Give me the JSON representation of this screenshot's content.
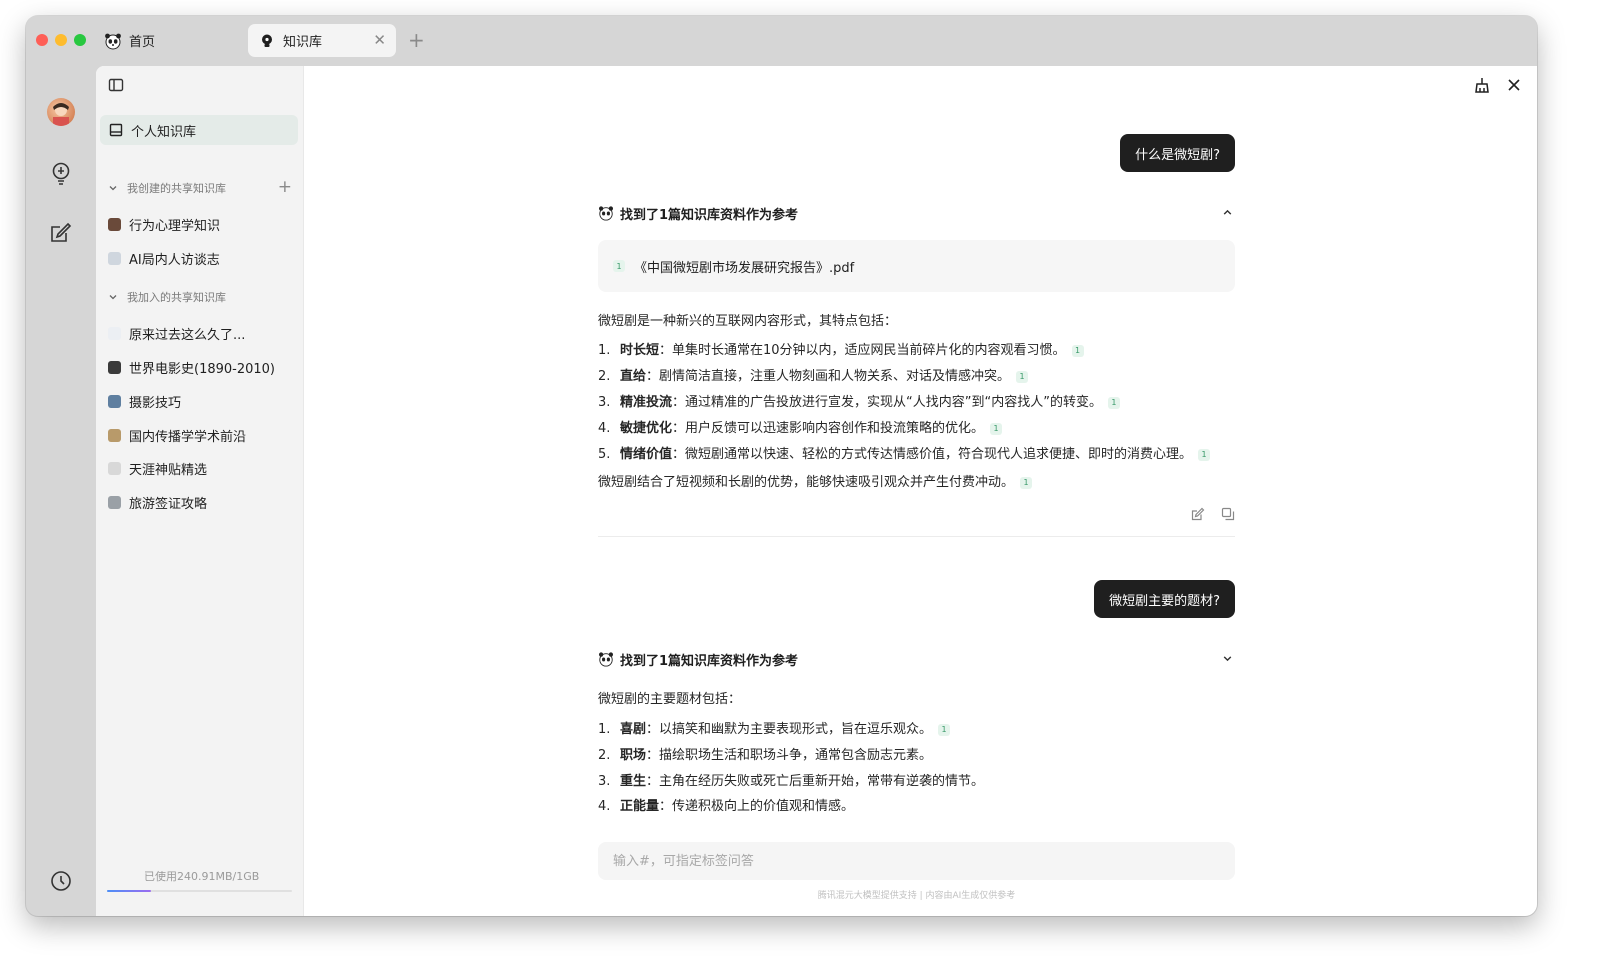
{
  "tabs": [
    {
      "label": "首页"
    },
    {
      "label": "知识库"
    }
  ],
  "sidebar": {
    "personal_label": "个人知识库",
    "created_section": "我创建的共享知识库",
    "created_items": [
      {
        "label": "行为心理学知识",
        "color": "#6a4a3a"
      },
      {
        "label": "AI局内人访谈志",
        "color": "#cfd6de"
      }
    ],
    "joined_section": "我加入的共享知识库",
    "joined_items": [
      {
        "label": "原来过去这么久了...",
        "color": "#eceff3"
      },
      {
        "label": "世界电影史(1890-2010)",
        "color": "#3a3a3a"
      },
      {
        "label": "摄影技巧",
        "color": "#5f7fa0"
      },
      {
        "label": "国内传播学学术前沿",
        "color": "#b89a6a"
      },
      {
        "label": "天涯神贴精选",
        "color": "#d8d8d8"
      },
      {
        "label": "旅游签证攻略",
        "color": "#9aa0a6"
      }
    ],
    "usage": "已使用240.91MB/1GB",
    "usage_fraction": 0.24
  },
  "chat": {
    "q1": "什么是微短剧?",
    "ref1_title": "找到了1篇知识库资料作为参考",
    "ref1_doc": "《中国微短剧市场发展研究报告》.pdf",
    "cite": "1",
    "a1_intro": "微短剧是一种新兴的互联网内容形式，其特点包括：",
    "a1_items": [
      {
        "num": "1.",
        "term": "时长短",
        "text": "：单集时长通常在10分钟以内，适应网民当前碎片化的内容观看习惯。"
      },
      {
        "num": "2.",
        "term": "直给",
        "text": "：剧情简洁直接，注重人物刻画和人物关系、对话及情感冲突。"
      },
      {
        "num": "3.",
        "term": "精准投流",
        "text": "：通过精准的广告投放进行宣发，实现从“人找内容”到“内容找人”的转变。"
      },
      {
        "num": "4.",
        "term": "敏捷优化",
        "text": "：用户反馈可以迅速影响内容创作和投流策略的优化。"
      },
      {
        "num": "5.",
        "term": "情绪价值",
        "text": "：微短剧通常以快速、轻松的方式传达情感价值，符合现代人追求便捷、即时的消费心理。"
      }
    ],
    "a1_outro": "微短剧结合了短视频和长剧的优势，能够快速吸引观众并产生付费冲动。",
    "q2": "微短剧主要的题材?",
    "ref2_title": "找到了1篇知识库资料作为参考",
    "a2_intro": "微短剧的主要题材包括：",
    "a2_items": [
      {
        "num": "1.",
        "term": "喜剧",
        "text": "：以搞笑和幽默为主要表现形式，旨在逗乐观众。"
      },
      {
        "num": "2.",
        "term": "职场",
        "text": "：描绘职场生活和职场斗争，通常包含励志元素。"
      },
      {
        "num": "3.",
        "term": "重生",
        "text": "：主角在经历失败或死亡后重新开始，常带有逆袭的情节。"
      },
      {
        "num": "4.",
        "term": "正能量",
        "text": "：传递积极向上的价值观和情感。"
      }
    ],
    "input_placeholder": "输入#，可指定标签问答",
    "footer": "腾讯混元大模型提供支持 | 内容由AI生成仅供参考"
  }
}
